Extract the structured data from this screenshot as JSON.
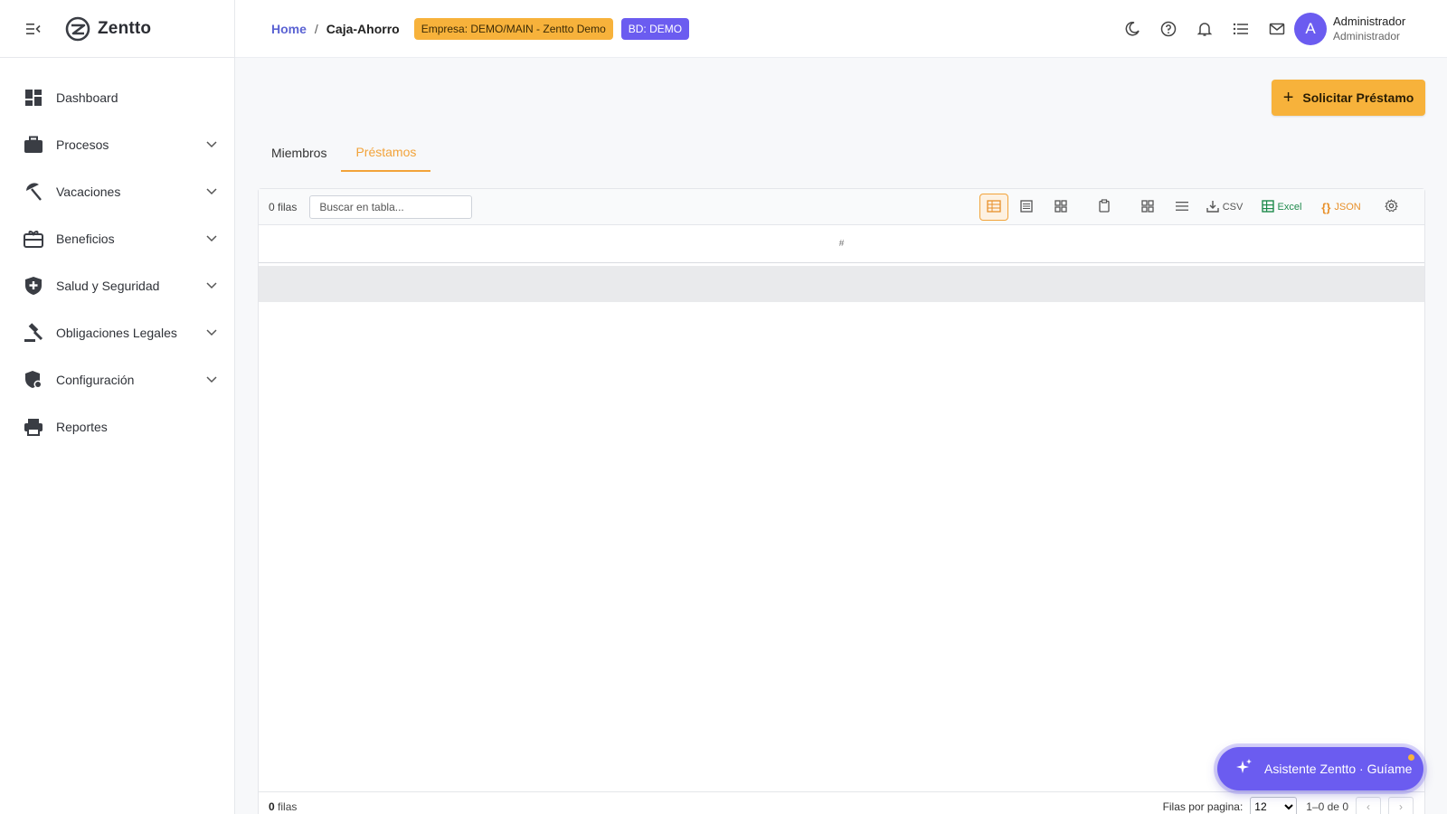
{
  "app": {
    "name": "Zentto"
  },
  "sidebar": {
    "items": [
      {
        "label": "Dashboard",
        "icon": "dashboard-icon",
        "expandable": false
      },
      {
        "label": "Procesos",
        "icon": "briefcase-icon",
        "expandable": true
      },
      {
        "label": "Vacaciones",
        "icon": "beach-umbrella-icon",
        "expandable": true
      },
      {
        "label": "Beneficios",
        "icon": "gift-card-icon",
        "expandable": true
      },
      {
        "label": "Salud y Seguridad",
        "icon": "shield-plus-icon",
        "expandable": true
      },
      {
        "label": "Obligaciones Legales",
        "icon": "gavel-icon",
        "expandable": true
      },
      {
        "label": "Configuración",
        "icon": "admin-shield-icon",
        "expandable": true
      },
      {
        "label": "Reportes",
        "icon": "printer-icon",
        "expandable": false
      }
    ]
  },
  "header": {
    "breadcrumb": {
      "home": "Home",
      "separator": "/",
      "current": "Caja-Ahorro"
    },
    "company_badge": "Empresa: DEMO/MAIN - Zentto Demo",
    "db_badge": "BD: DEMO",
    "icons": [
      "moon-icon",
      "help-icon",
      "bell-icon",
      "list-icon",
      "mail-icon"
    ],
    "user": {
      "initial": "A",
      "name": "Administrador",
      "role": "Administrador"
    }
  },
  "main": {
    "primary_action": "Solicitar Préstamo",
    "tabs": [
      {
        "label": "Miembros",
        "active": false
      },
      {
        "label": "Préstamos",
        "active": true
      }
    ],
    "grid": {
      "row_count": "0 filas",
      "search_placeholder": "Buscar en tabla...",
      "toolbar": {
        "csv": "CSV",
        "excel": "Excel",
        "json": "JSON"
      },
      "column_header": "#",
      "footer": {
        "count_number": "0",
        "count_label": "filas",
        "rows_per_page_label": "Filas por pagina:",
        "rows_per_page_value": "12",
        "range": "1–0 de 0",
        "prev": "‹",
        "next": "›"
      }
    }
  },
  "assistant": {
    "label": "Asistente Zentto · Guíame"
  },
  "colors": {
    "accent_orange": "#f7b23b",
    "accent_purple": "#6b5cf0",
    "excel_green": "#1f8a4c"
  }
}
